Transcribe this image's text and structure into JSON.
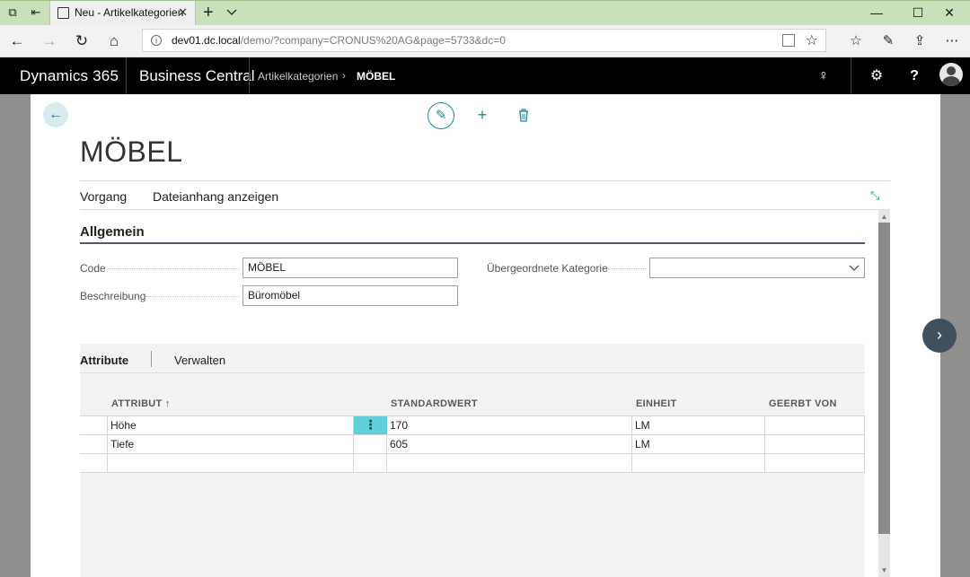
{
  "browser": {
    "tab_title": "Neu - Artikelkategorien",
    "url_host": "dev01.dc.local",
    "url_path": "/demo/?company=CRONUS%20AG&page=5733&dc=0"
  },
  "header": {
    "brand": "Dynamics 365",
    "app": "Business Central",
    "breadcrumb_parent": "Artikelkategorien",
    "breadcrumb_current": "MÖBEL"
  },
  "page": {
    "title": "MÖBEL",
    "actions": [
      "Vorgang",
      "Dateianhang anzeigen"
    ]
  },
  "general": {
    "heading": "Allgemein",
    "code_label": "Code",
    "code_value": "MÖBEL",
    "description_label": "Beschreibung",
    "description_value": "Büromöbel",
    "parent_label": "Übergeordnete Kategorie",
    "parent_value": ""
  },
  "attributes": {
    "tab_label": "Attribute",
    "manage_label": "Verwalten",
    "columns": [
      "ATTRIBUT ↑",
      "STANDARDWERT",
      "EINHEIT",
      "GEERBT VON"
    ],
    "rows": [
      {
        "attribute": "Höhe",
        "default": "170",
        "unit": "LM",
        "inherited": ""
      },
      {
        "attribute": "Tiefe",
        "default": "605",
        "unit": "LM",
        "inherited": ""
      },
      {
        "attribute": "",
        "default": "",
        "unit": "",
        "inherited": ""
      }
    ]
  },
  "colors": {
    "accent": "#1a8b94",
    "header_bg": "#000000",
    "tabbar": "#c9e0bb",
    "row_selected": "#5fcfd9"
  },
  "icons": {
    "edit": "pencil-icon",
    "new": "plus-icon",
    "delete": "trash-icon",
    "back": "arrow-left-icon",
    "next": "chevron-right-icon"
  }
}
